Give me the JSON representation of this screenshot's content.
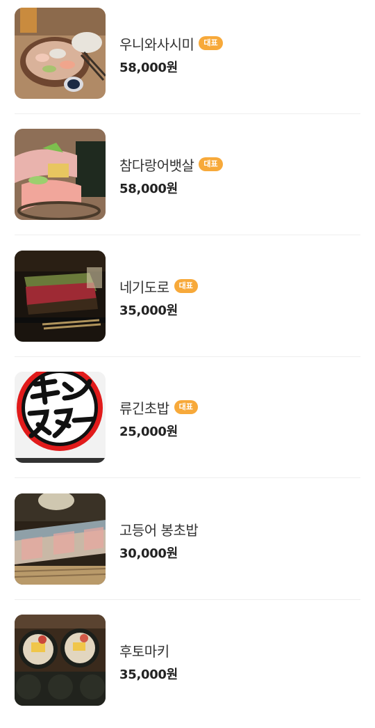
{
  "menu": {
    "items": [
      {
        "name": "우니와사시미",
        "badge": "대표",
        "price": "58,000원",
        "photo": "uni-sashimi-photo"
      },
      {
        "name": "참다랑어뱃살",
        "badge": "대표",
        "price": "58,000원",
        "photo": "tuna-belly-photo"
      },
      {
        "name": "네기도로",
        "badge": "대표",
        "price": "35,000원",
        "photo": "negitoro-photo"
      },
      {
        "name": "류긴초밥",
        "badge": "대표",
        "price": "25,000원",
        "photo": "monstar-logo-image"
      },
      {
        "name": "고등어 봉초밥",
        "badge": "",
        "price": "30,000원",
        "photo": "mackerel-bo-sushi-photo"
      },
      {
        "name": "후토마키",
        "badge": "",
        "price": "35,000원",
        "photo": "futomaki-photo"
      }
    ]
  },
  "colors": {
    "badge": "#f7a93a",
    "text": "#333333",
    "price": "#222222",
    "divider": "#eeeeee"
  }
}
